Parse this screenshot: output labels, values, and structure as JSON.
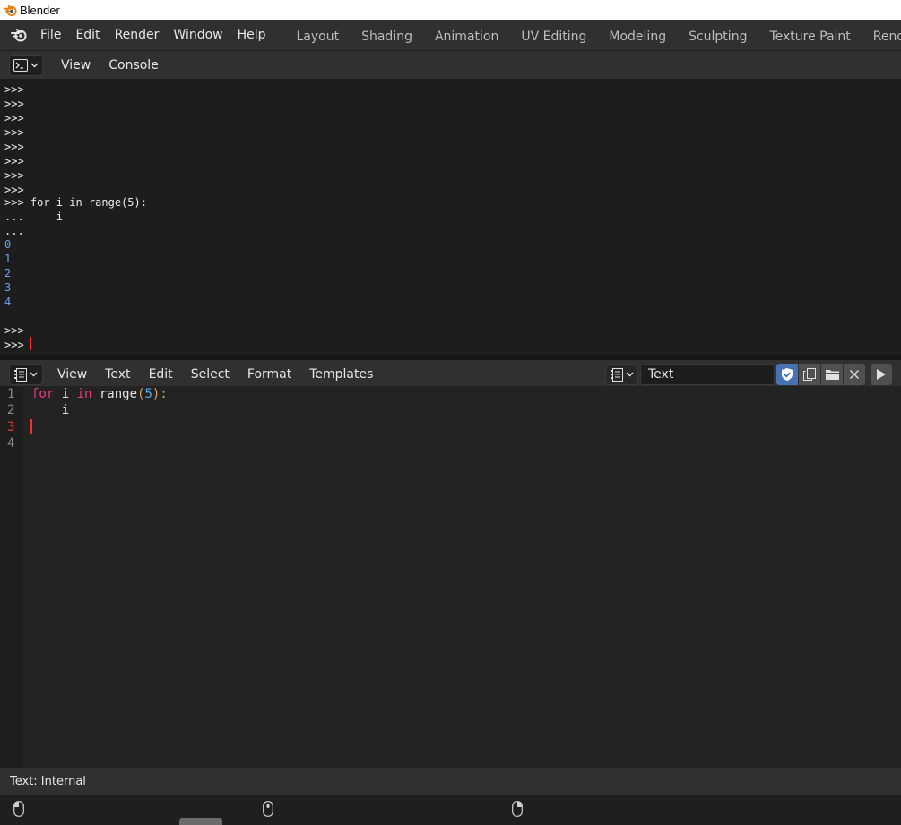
{
  "window": {
    "title": "Blender"
  },
  "top_menu": [
    "File",
    "Edit",
    "Render",
    "Window",
    "Help"
  ],
  "workspace_tabs": [
    "Layout",
    "Shading",
    "Animation",
    "UV Editing",
    "Modeling",
    "Sculpting",
    "Texture Paint",
    "Rendering"
  ],
  "console": {
    "header_menus": [
      "View",
      "Console"
    ],
    "lines": [
      {
        "text": ">>>",
        "type": "prompt"
      },
      {
        "text": ">>>",
        "type": "prompt"
      },
      {
        "text": ">>>",
        "type": "prompt"
      },
      {
        "text": ">>>",
        "type": "prompt"
      },
      {
        "text": ">>>",
        "type": "prompt"
      },
      {
        "text": ">>>",
        "type": "prompt"
      },
      {
        "text": ">>>",
        "type": "prompt"
      },
      {
        "text": ">>>",
        "type": "prompt"
      },
      {
        "text": ">>> for i in range(5):",
        "type": "input"
      },
      {
        "text": "...     i",
        "type": "input"
      },
      {
        "text": "...",
        "type": "input"
      },
      {
        "text": "0",
        "type": "output"
      },
      {
        "text": "1",
        "type": "output"
      },
      {
        "text": "2",
        "type": "output"
      },
      {
        "text": "3",
        "type": "output"
      },
      {
        "text": "4",
        "type": "output"
      },
      {
        "text": "",
        "type": "output"
      },
      {
        "text": ">>>",
        "type": "prompt"
      },
      {
        "text": ">>>",
        "type": "prompt"
      }
    ]
  },
  "text_editor": {
    "header_menus": [
      "View",
      "Text",
      "Edit",
      "Select",
      "Format",
      "Templates"
    ],
    "text_name": "Text",
    "line_numbers": [
      "1",
      "2",
      "3",
      "4"
    ],
    "current_line": 3,
    "code": {
      "line1": {
        "kw1": "for",
        "mid1": " i ",
        "kw2": "in",
        "mid2": " range",
        "open": "(",
        "num": "5",
        "close": "):"
      },
      "line2": "    i"
    }
  },
  "status": {
    "text": "Text: Internal"
  },
  "colors": {
    "accent": "#4772b3",
    "cursor": "#ff2a2a",
    "output": "#6e9ff0",
    "keyword": "#ec3a7a"
  }
}
